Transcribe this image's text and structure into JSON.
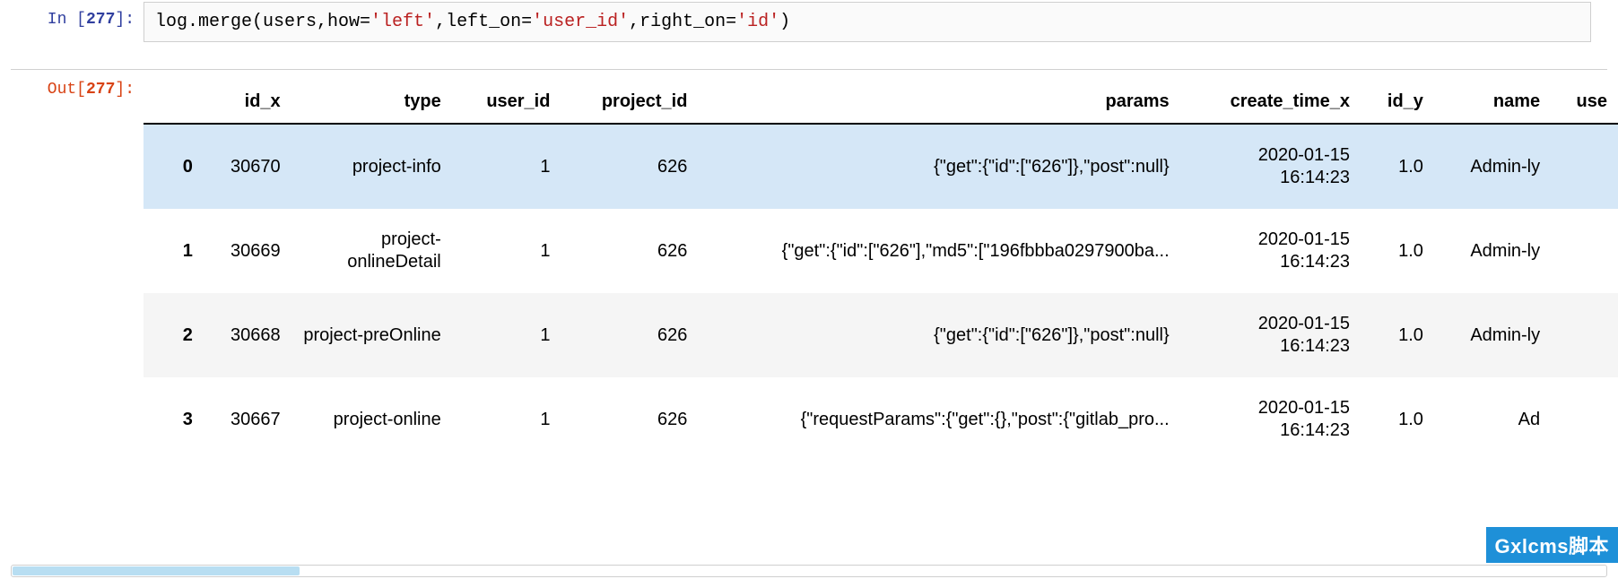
{
  "input": {
    "prompt_label": "In [",
    "prompt_num": "277",
    "prompt_close": "]:",
    "code_p1": "log.merge(users,how=",
    "code_s1": "'left'",
    "code_p2": ",left_on=",
    "code_s2": "'user_id'",
    "code_p3": ",right_on=",
    "code_s3": "'id'",
    "code_p4": ")"
  },
  "output": {
    "prompt_label": "Out[",
    "prompt_num": "277",
    "prompt_close": "]:"
  },
  "columns": [
    "id_x",
    "type",
    "user_id",
    "project_id",
    "params",
    "create_time_x",
    "id_y",
    "name",
    "use"
  ],
  "rows": [
    {
      "idx": "0",
      "id_x": "30670",
      "type": "project-info",
      "user_id": "1",
      "project_id": "626",
      "params": "{\"get\":{\"id\":[\"626\"]},\"post\":null}",
      "create_time_x": "2020-01-15 16:14:23",
      "id_y": "1.0",
      "name": "Admin-ly"
    },
    {
      "idx": "1",
      "id_x": "30669",
      "type": "project-onlineDetail",
      "user_id": "1",
      "project_id": "626",
      "params": "{\"get\":{\"id\":[\"626\"],\"md5\":[\"196fbbba0297900ba...",
      "create_time_x": "2020-01-15 16:14:23",
      "id_y": "1.0",
      "name": "Admin-ly"
    },
    {
      "idx": "2",
      "id_x": "30668",
      "type": "project-preOnline",
      "user_id": "1",
      "project_id": "626",
      "params": "{\"get\":{\"id\":[\"626\"]},\"post\":null}",
      "create_time_x": "2020-01-15 16:14:23",
      "id_y": "1.0",
      "name": "Admin-ly"
    },
    {
      "idx": "3",
      "id_x": "30667",
      "type": "project-online",
      "user_id": "1",
      "project_id": "626",
      "params": "{\"requestParams\":{\"get\":{},\"post\":{\"gitlab_pro...",
      "create_time_x": "2020-01-15 16:14:23",
      "id_y": "1.0",
      "name": "Ad"
    }
  ],
  "badge": "Gxlcms脚本"
}
